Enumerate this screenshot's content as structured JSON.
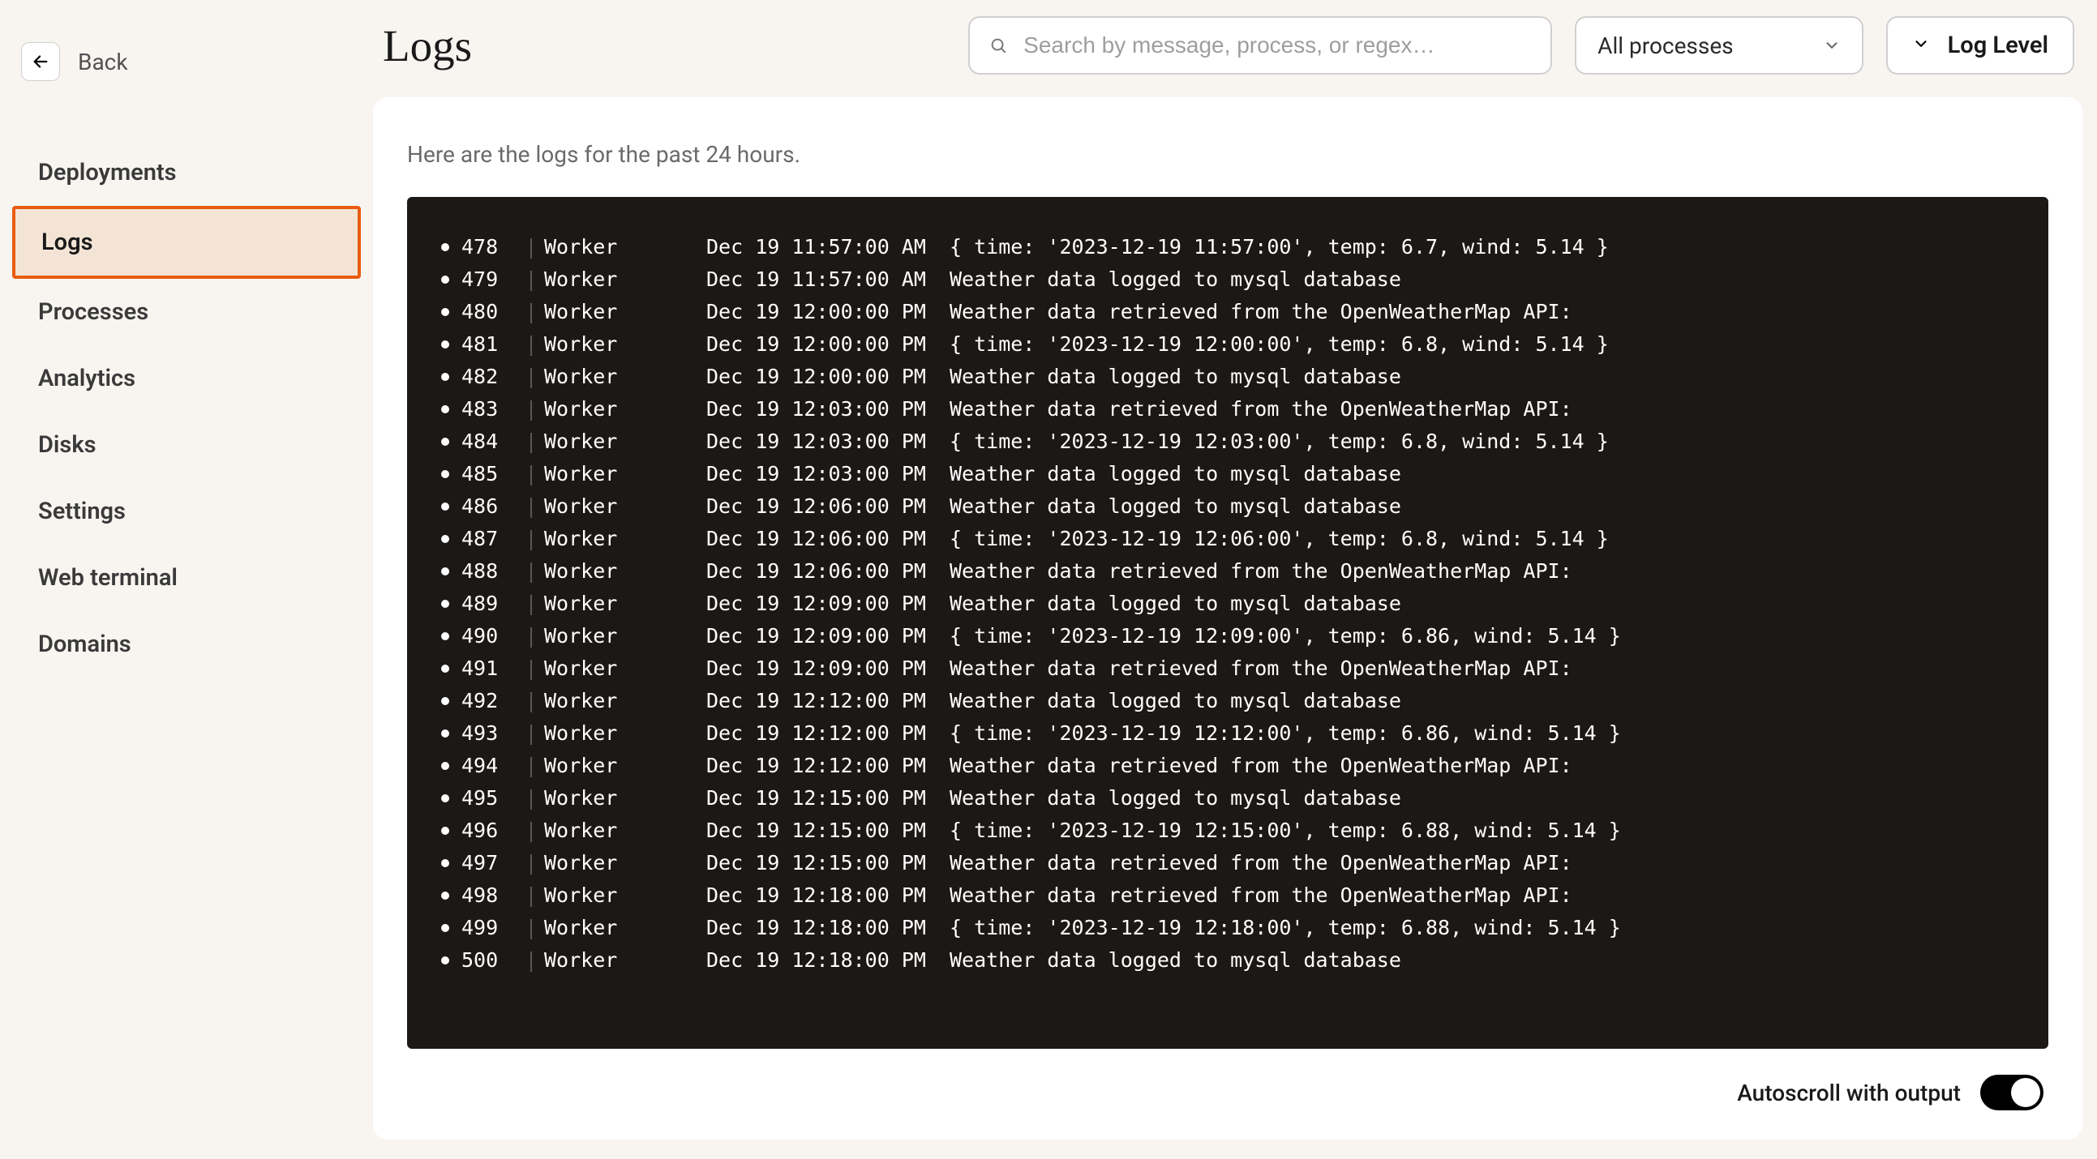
{
  "back_label": "Back",
  "page_title": "Logs",
  "search_placeholder": "Search by message, process, or regex…",
  "process_filter_label": "All processes",
  "loglevel_label": "Log Level",
  "subtitle": "Here are the logs for the past 24 hours.",
  "autoscroll_label": "Autoscroll with output",
  "nav": [
    {
      "label": "Deployments",
      "active": false
    },
    {
      "label": "Logs",
      "active": true
    },
    {
      "label": "Processes",
      "active": false
    },
    {
      "label": "Analytics",
      "active": false
    },
    {
      "label": "Disks",
      "active": false
    },
    {
      "label": "Settings",
      "active": false
    },
    {
      "label": "Web terminal",
      "active": false
    },
    {
      "label": "Domains",
      "active": false
    }
  ],
  "logs": [
    {
      "n": "478",
      "proc": "Worker",
      "ts": "Dec 19 11:57:00 AM",
      "msg": "{ time: '2023-12-19 11:57:00', temp: 6.7, wind: 5.14 }"
    },
    {
      "n": "479",
      "proc": "Worker",
      "ts": "Dec 19 11:57:00 AM",
      "msg": "Weather data logged to mysql database"
    },
    {
      "n": "480",
      "proc": "Worker",
      "ts": "Dec 19 12:00:00 PM",
      "msg": "Weather data retrieved from the OpenWeatherMap API:"
    },
    {
      "n": "481",
      "proc": "Worker",
      "ts": "Dec 19 12:00:00 PM",
      "msg": "{ time: '2023-12-19 12:00:00', temp: 6.8, wind: 5.14 }"
    },
    {
      "n": "482",
      "proc": "Worker",
      "ts": "Dec 19 12:00:00 PM",
      "msg": "Weather data logged to mysql database"
    },
    {
      "n": "483",
      "proc": "Worker",
      "ts": "Dec 19 12:03:00 PM",
      "msg": "Weather data retrieved from the OpenWeatherMap API:"
    },
    {
      "n": "484",
      "proc": "Worker",
      "ts": "Dec 19 12:03:00 PM",
      "msg": "{ time: '2023-12-19 12:03:00', temp: 6.8, wind: 5.14 }"
    },
    {
      "n": "485",
      "proc": "Worker",
      "ts": "Dec 19 12:03:00 PM",
      "msg": "Weather data logged to mysql database"
    },
    {
      "n": "486",
      "proc": "Worker",
      "ts": "Dec 19 12:06:00 PM",
      "msg": "Weather data logged to mysql database"
    },
    {
      "n": "487",
      "proc": "Worker",
      "ts": "Dec 19 12:06:00 PM",
      "msg": "{ time: '2023-12-19 12:06:00', temp: 6.8, wind: 5.14 }"
    },
    {
      "n": "488",
      "proc": "Worker",
      "ts": "Dec 19 12:06:00 PM",
      "msg": "Weather data retrieved from the OpenWeatherMap API:"
    },
    {
      "n": "489",
      "proc": "Worker",
      "ts": "Dec 19 12:09:00 PM",
      "msg": "Weather data logged to mysql database"
    },
    {
      "n": "490",
      "proc": "Worker",
      "ts": "Dec 19 12:09:00 PM",
      "msg": "{ time: '2023-12-19 12:09:00', temp: 6.86, wind: 5.14 }"
    },
    {
      "n": "491",
      "proc": "Worker",
      "ts": "Dec 19 12:09:00 PM",
      "msg": "Weather data retrieved from the OpenWeatherMap API:"
    },
    {
      "n": "492",
      "proc": "Worker",
      "ts": "Dec 19 12:12:00 PM",
      "msg": "Weather data logged to mysql database"
    },
    {
      "n": "493",
      "proc": "Worker",
      "ts": "Dec 19 12:12:00 PM",
      "msg": "{ time: '2023-12-19 12:12:00', temp: 6.86, wind: 5.14 }"
    },
    {
      "n": "494",
      "proc": "Worker",
      "ts": "Dec 19 12:12:00 PM",
      "msg": "Weather data retrieved from the OpenWeatherMap API:"
    },
    {
      "n": "495",
      "proc": "Worker",
      "ts": "Dec 19 12:15:00 PM",
      "msg": "Weather data logged to mysql database"
    },
    {
      "n": "496",
      "proc": "Worker",
      "ts": "Dec 19 12:15:00 PM",
      "msg": "{ time: '2023-12-19 12:15:00', temp: 6.88, wind: 5.14 }"
    },
    {
      "n": "497",
      "proc": "Worker",
      "ts": "Dec 19 12:15:00 PM",
      "msg": "Weather data retrieved from the OpenWeatherMap API:"
    },
    {
      "n": "498",
      "proc": "Worker",
      "ts": "Dec 19 12:18:00 PM",
      "msg": "Weather data retrieved from the OpenWeatherMap API:"
    },
    {
      "n": "499",
      "proc": "Worker",
      "ts": "Dec 19 12:18:00 PM",
      "msg": "{ time: '2023-12-19 12:18:00', temp: 6.88, wind: 5.14 }"
    },
    {
      "n": "500",
      "proc": "Worker",
      "ts": "Dec 19 12:18:00 PM",
      "msg": "Weather data logged to mysql database"
    }
  ]
}
